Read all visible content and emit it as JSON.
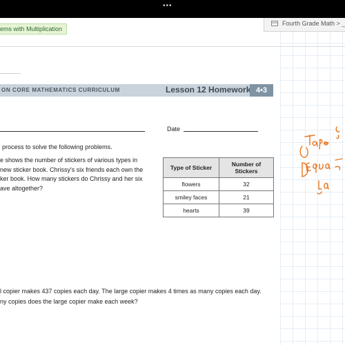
{
  "window": {
    "more_menu": "•••"
  },
  "tabs": {
    "left_label": "ems with Multiplication",
    "right_label": "Fourth Grade Math > _Co"
  },
  "document": {
    "curriculum_banner": "ON CORE MATHEMATICS CURRICULUM",
    "lesson_title": "Lesson 12 Homework",
    "lesson_badge": "4•3",
    "date_label": "Date",
    "instructions": "process to solve the following problems.",
    "problem1_lines": [
      "e shows the number of stickers of various types in",
      "new sticker book.  Chrissy's six friends each own the",
      "ker book.  How many stickers do Chrissy and her six",
      "ave altogether?"
    ],
    "sticker_table": {
      "headers": [
        "Type of Sticker",
        "Number of Stickers"
      ],
      "rows": [
        {
          "type": "flowers",
          "count": "32"
        },
        {
          "type": "smiley faces",
          "count": "21"
        },
        {
          "type": "hearts",
          "count": "39"
        }
      ]
    },
    "problem2_lines": [
      "l copier makes 437 copies each day.  The large copier makes 4 times as many copies each day.",
      "ny copies does the large copier make each week?"
    ]
  },
  "annotations": {
    "ink_color": "#e8761e",
    "handwriting": "Tape D... Equa... la..."
  }
}
